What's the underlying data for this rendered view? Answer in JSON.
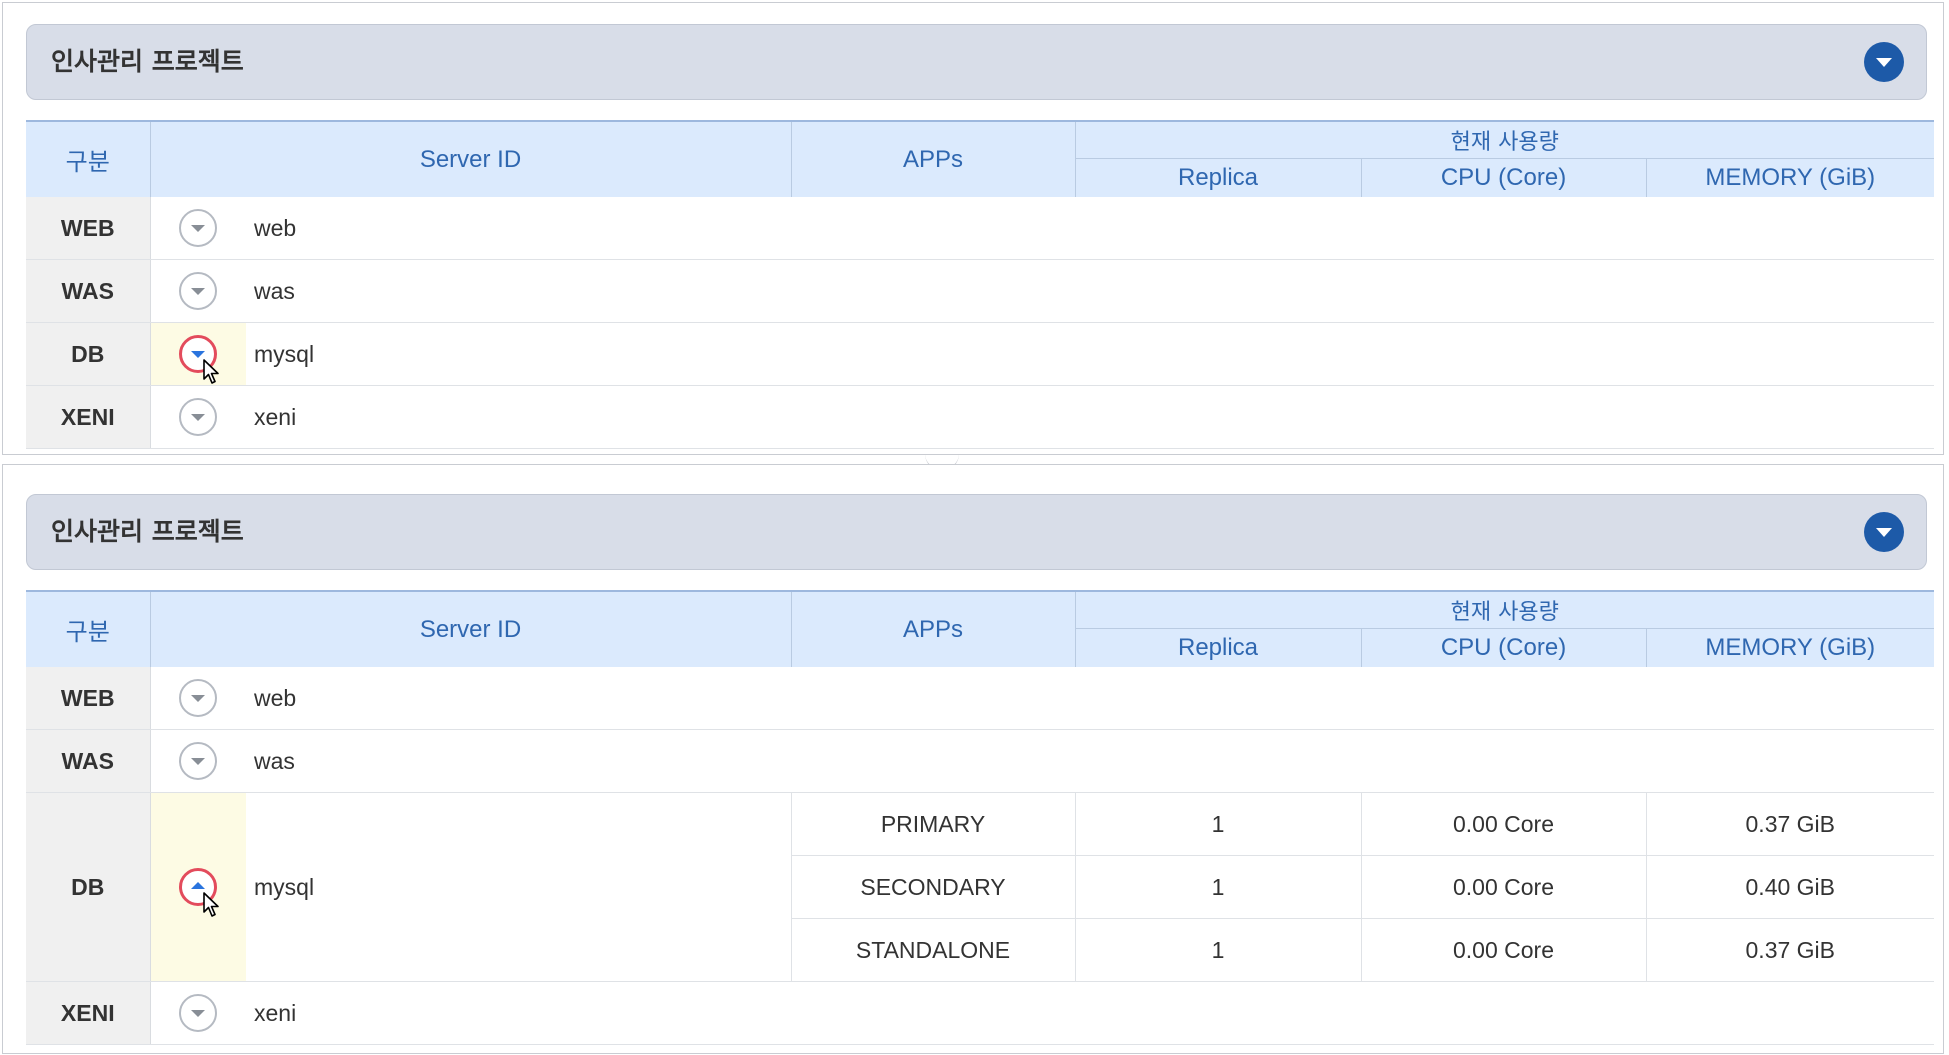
{
  "project": {
    "title": "인사관리 프로젝트"
  },
  "columns": {
    "gubun": "구분",
    "server_id": "Server ID",
    "apps": "APPs",
    "usage_group": "현재 사용량",
    "replica": "Replica",
    "cpu": "CPU (Core)",
    "memory": "MEMORY (GiB)"
  },
  "rows": {
    "web": {
      "gubun": "WEB",
      "server": "web"
    },
    "was": {
      "gubun": "WAS",
      "server": "was"
    },
    "db": {
      "gubun": "DB",
      "server": "mysql"
    },
    "xeni": {
      "gubun": "XENI",
      "server": "xeni"
    }
  },
  "db_apps": [
    {
      "app": "PRIMARY",
      "replica": "1",
      "cpu": "0.00 Core",
      "memory": "0.37 GiB"
    },
    {
      "app": "SECONDARY",
      "replica": "1",
      "cpu": "0.00 Core",
      "memory": "0.40 GiB"
    },
    {
      "app": "STANDALONE",
      "replica": "1",
      "cpu": "0.00 Core",
      "memory": "0.37 GiB"
    }
  ]
}
